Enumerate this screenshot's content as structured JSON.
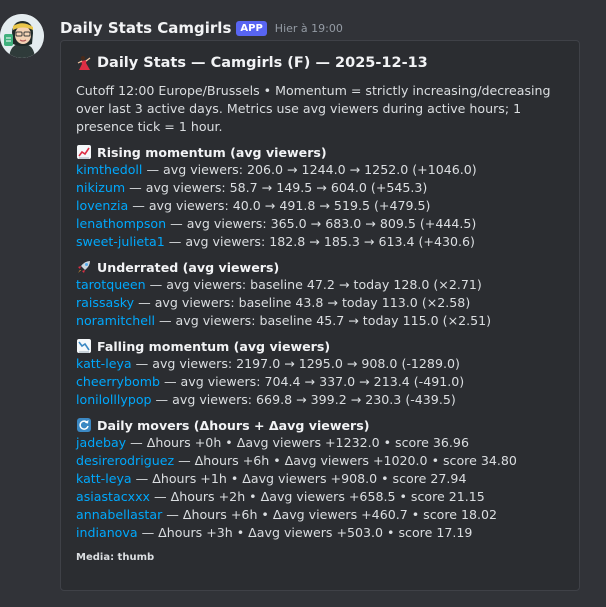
{
  "message": {
    "username": "Daily Stats Camgirls",
    "badge": "APP",
    "timestamp": "Hier à 19:00",
    "avatar_icon": "cartoon-character-avatar"
  },
  "embed": {
    "title": "Daily Stats — Camgirls (F) — 2025-12-13",
    "title_icon": "dancer-icon",
    "description": "Cutoff 12:00 Europe/Brussels • Momentum = strictly increasing/decreasing over last 3 active days. Metrics use avg viewers during active hours; 1 presence tick = 1 hour.",
    "sections": [
      {
        "title": "Rising momentum (avg viewers)",
        "icon": "chart-increasing-icon",
        "rows": [
          {
            "user": "kimthedoll",
            "text": " — avg viewers: 206.0 → 1244.0 → 1252.0 (+1046.0)"
          },
          {
            "user": "nikizum",
            "text": " — avg viewers: 58.7 → 149.5 → 604.0 (+545.3)"
          },
          {
            "user": "lovenzia",
            "text": " — avg viewers: 40.0 → 491.8 → 519.5 (+479.5)"
          },
          {
            "user": "lenathompson",
            "text": " — avg viewers: 365.0 → 683.0 → 809.5 (+444.5)"
          },
          {
            "user": "sweet-julieta1",
            "text": " — avg viewers: 182.8 → 185.3 → 613.4 (+430.6)"
          }
        ]
      },
      {
        "title": "Underrated (avg viewers)",
        "icon": "rocket-icon",
        "rows": [
          {
            "user": "tarotqueen",
            "text": " — avg viewers: baseline 47.2 → today 128.0 (×2.71)"
          },
          {
            "user": "raissasky",
            "text": " — avg viewers: baseline 43.8 → today 113.0 (×2.58)"
          },
          {
            "user": "noramitchell",
            "text": " — avg viewers: baseline 45.7 → today 115.0 (×2.51)"
          }
        ]
      },
      {
        "title": "Falling momentum (avg viewers)",
        "icon": "chart-decreasing-icon",
        "rows": [
          {
            "user": "katt-leya",
            "text": " — avg viewers: 2197.0 → 1295.0 → 908.0 (-1289.0)"
          },
          {
            "user": "cheerrybomb",
            "text": " — avg viewers: 704.4 → 337.0 → 213.4 (-491.0)"
          },
          {
            "user": "lonilolllypop",
            "text": " — avg viewers: 669.8 → 399.2 → 230.3 (-439.5)"
          }
        ]
      },
      {
        "title": "Daily movers (Δhours + Δavg viewers)",
        "icon": "arrows-counterclockwise-icon",
        "rows": [
          {
            "user": "jadebay",
            "text": " — Δhours +0h • Δavg viewers +1232.0 • score 36.96"
          },
          {
            "user": "desirerodriguez",
            "text": " — Δhours +6h • Δavg viewers +1020.0 • score 34.80"
          },
          {
            "user": "katt-leya",
            "text": " — Δhours +1h • Δavg viewers +908.0 • score 27.94"
          },
          {
            "user": "asiastacxxx",
            "text": " — Δhours +2h • Δavg viewers +658.5 • score 21.15"
          },
          {
            "user": "annabellastar",
            "text": " — Δhours +6h • Δavg viewers +460.7 • score 18.02"
          },
          {
            "user": "indianova",
            "text": " — Δhours +3h • Δavg viewers +503.0 • score 17.19"
          }
        ]
      }
    ],
    "footer": "Media: thumb"
  },
  "colors": {
    "background": "#313338",
    "embed_background": "#2b2d31",
    "link": "#00a8fc",
    "badge": "#5865f2"
  }
}
